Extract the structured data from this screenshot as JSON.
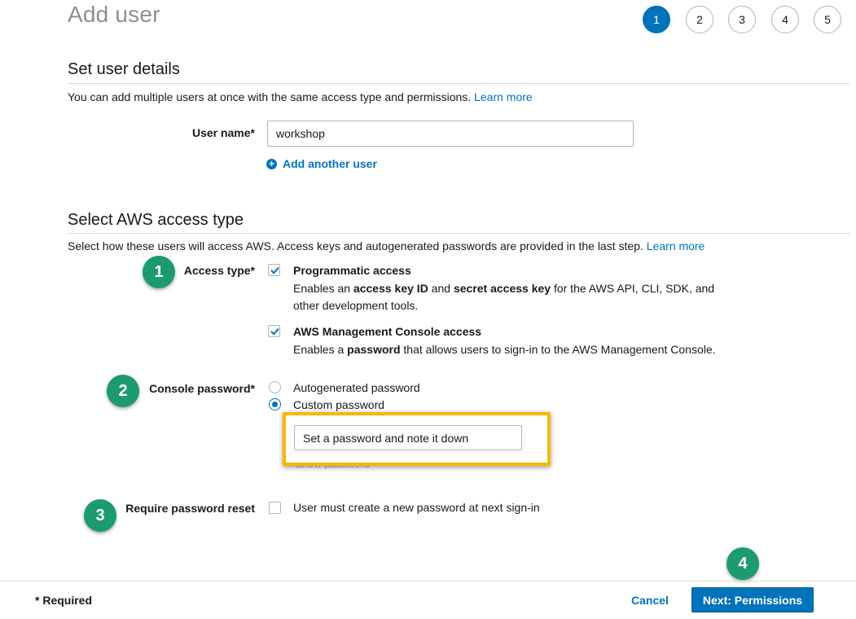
{
  "page": {
    "title": "Add user"
  },
  "steps": [
    "1",
    "2",
    "3",
    "4",
    "5"
  ],
  "details": {
    "title": "Set user details",
    "description": "You can add multiple users at once with the same access type and permissions.",
    "learn_more": "Learn more",
    "username_label": "User name*",
    "username_value": "workshop",
    "add_another": "Add another user"
  },
  "access": {
    "title": "Select AWS access type",
    "description": "Select how these users will access AWS. Access keys and autogenerated passwords are provided in the last step.",
    "learn_more": "Learn more",
    "type_label": "Access type*",
    "programmatic_title": "Programmatic access",
    "programmatic_desc_1": "Enables an ",
    "programmatic_desc_b1": "access key ID",
    "programmatic_desc_2": " and ",
    "programmatic_desc_b2": "secret access key",
    "programmatic_desc_3": " for the AWS API, CLI, SDK, and other development tools.",
    "console_title": "AWS Management Console access",
    "console_desc_1": "Enables a ",
    "console_desc_b1": "password",
    "console_desc_2": " that allows users to sign-in to the AWS Management Console.",
    "password_label": "Console password*",
    "autogenerated": "Autogenerated password",
    "custom": "Custom password",
    "password_value": "Set a password and note it down",
    "show_password": "Show password",
    "reset_label": "Require password reset",
    "reset_text": "User must create a new password at next sign-in"
  },
  "badges": [
    "1",
    "2",
    "3",
    "4"
  ],
  "footer": {
    "required": "* Required",
    "cancel": "Cancel",
    "next": "Next: Permissions"
  },
  "colors": {
    "accent": "#0073bb",
    "badge": "#1d9a72",
    "highlight": "#f9b800"
  }
}
